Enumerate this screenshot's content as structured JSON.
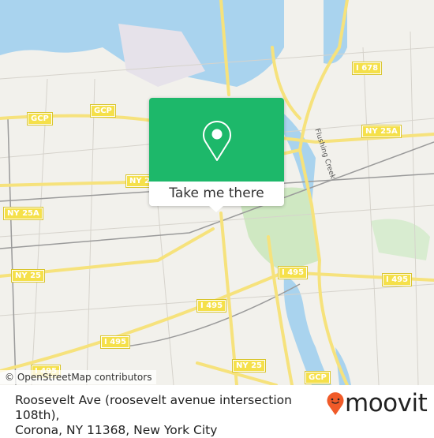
{
  "map": {
    "attribution": "© OpenStreetMap contributors",
    "road_labels": [
      "I 678",
      "GCP",
      "GCP",
      "NY 25A",
      "NY 25A",
      "NY 25A",
      "NY 2",
      "NY 25",
      "NY 25",
      "I 495",
      "I 495",
      "I 495",
      "I 495",
      "I 495",
      "GCP",
      "Flushing Creek"
    ],
    "colors": {
      "water": "#a9d3ee",
      "park": "#cfe8c2",
      "land": "#f2f1ec",
      "highway": "#f6e27c",
      "accent": "#1db86a"
    }
  },
  "popup": {
    "icon": "location-pin-icon",
    "action_label": "Take me there"
  },
  "footer": {
    "address_line1": "Roosevelt Ave (roosevelt avenue intersection 108th),",
    "address_line2": "Corona, NY 11368, New York City",
    "brand": "moovit",
    "brand_color": "#f05a28"
  }
}
